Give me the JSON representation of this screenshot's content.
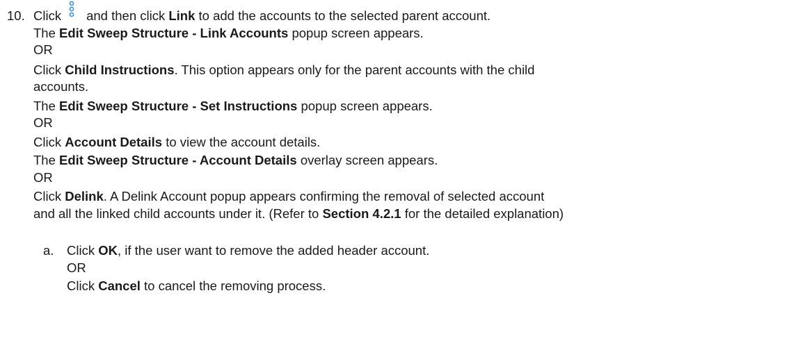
{
  "step": {
    "number": "10.",
    "l1_a": "Click",
    "l1_b": "and then click",
    "l1_link": "Link",
    "l1_c": "to add the accounts to the selected parent account.",
    "l2_a": "The",
    "l2_b": "Edit Sweep Structure - Link Accounts",
    "l2_c": "popup screen appears.",
    "or1": "OR",
    "l4_a": "Click",
    "l4_b": "Child Instructions",
    "l4_c": ". This option appears only for the parent accounts with the child",
    "l5": "accounts.",
    "l6_a": "The",
    "l6_b": "Edit Sweep Structure - Set Instructions",
    "l6_c": "popup screen appears.",
    "or2": "OR",
    "l8_a": "Click",
    "l8_b": "Account Details",
    "l8_c": "to view the account details.",
    "l9_a": "The",
    "l9_b": "Edit Sweep Structure - Account Details",
    "l9_c": "overlay screen appears.",
    "or3": "OR",
    "l11_a": "Click",
    "l11_b": "Delink",
    "l11_c": ". A Delink Account popup appears confirming the removal of selected account",
    "l12_a": "and all the linked child accounts under it. (Refer to",
    "l12_b": "Section 4.2.1",
    "l12_c": "for the detailed explanation)"
  },
  "substep": {
    "letter": "a.",
    "s1_a": "Click",
    "s1_b": "OK",
    "s1_c": ", if the user want to remove the added header account.",
    "or": "OR",
    "s3_a": "Click",
    "s3_b": "Cancel",
    "s3_c": "to cancel the removing process."
  },
  "icons": {
    "kebab": "kebab-menu-icon",
    "kebab_color": "#3a8fd8"
  }
}
